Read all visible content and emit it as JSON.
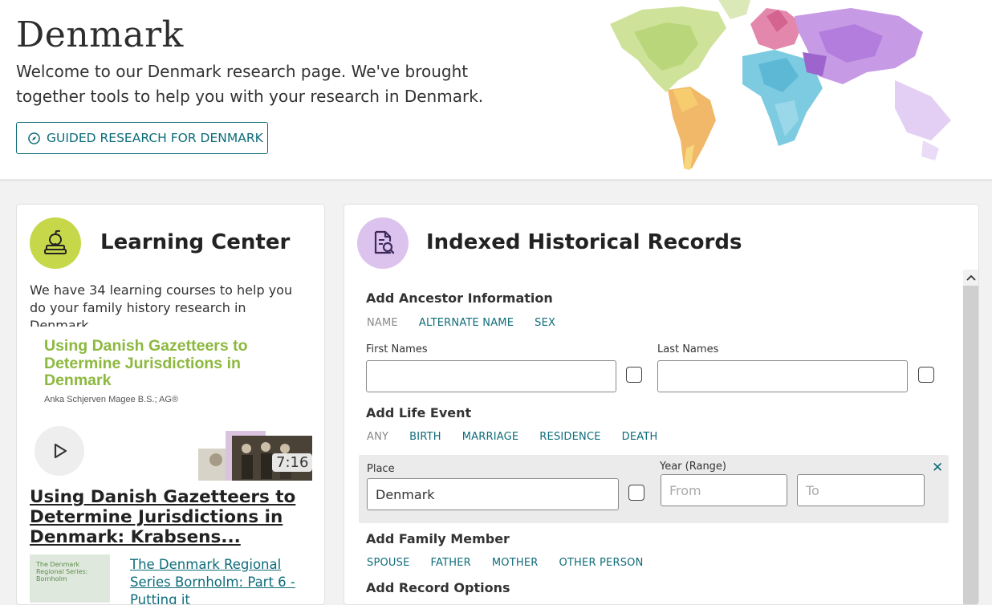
{
  "hero": {
    "title": "Denmark",
    "intro": "Welcome to our Denmark research page. We've brought together tools to help you with your research in Denmark.",
    "guided_button": "GUIDED RESEARCH FOR DENMARK"
  },
  "learning_center": {
    "title": "Learning Center",
    "description": "We have 34 learning courses to help you do your family history research in Denmark.",
    "video": {
      "thumb_title": "Using Danish Gazetteers to Determine Jurisdictions in Denmark",
      "thumb_author": "Anka Schjerven Magee B.S.; AG®",
      "duration": "7:16",
      "link": "Using Danish Gazetteers to Determine Jurisdictions in Denmark: Krabsens..."
    },
    "next_item": {
      "thumb_text": "The Denmark Regional Series: Bornholm",
      "link": "The Denmark Regional Series Bornholm: Part 6 - Putting it"
    }
  },
  "records": {
    "title": "Indexed Historical Records",
    "ancestor": {
      "title": "Add Ancestor Information",
      "tabs": [
        "NAME",
        "ALTERNATE NAME",
        "SEX"
      ],
      "first_label": "First Names",
      "last_label": "Last Names",
      "first_value": "",
      "last_value": ""
    },
    "life_event": {
      "title": "Add Life Event",
      "tabs": [
        "ANY",
        "BIRTH",
        "MARRIAGE",
        "RESIDENCE",
        "DEATH"
      ],
      "place_label": "Place",
      "place_value": "Denmark",
      "year_label": "Year (Range)",
      "from_placeholder": "From",
      "to_placeholder": "To",
      "close": "✕"
    },
    "family": {
      "title": "Add Family Member",
      "tabs": [
        "SPOUSE",
        "FATHER",
        "MOTHER",
        "OTHER PERSON"
      ]
    },
    "record_options_title": "Add Record Options"
  },
  "colors": {
    "accent": "#0e6c7a",
    "lc_icon_bg": "#c6d84a",
    "ir_icon_bg": "#dcc3ee"
  }
}
